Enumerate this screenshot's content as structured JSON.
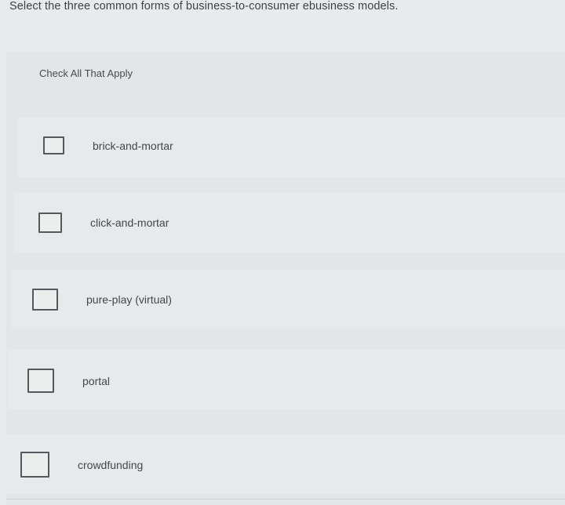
{
  "question": "Select the three common forms of business-to-consumer ebusiness models.",
  "instruction": "Check All That Apply",
  "options": [
    {
      "label": "brick-and-mortar",
      "checked": false
    },
    {
      "label": "click-and-mortar",
      "checked": false
    },
    {
      "label": "pure-play (virtual)",
      "checked": false
    },
    {
      "label": "portal",
      "checked": false
    },
    {
      "label": "crowdfunding",
      "checked": false
    }
  ]
}
